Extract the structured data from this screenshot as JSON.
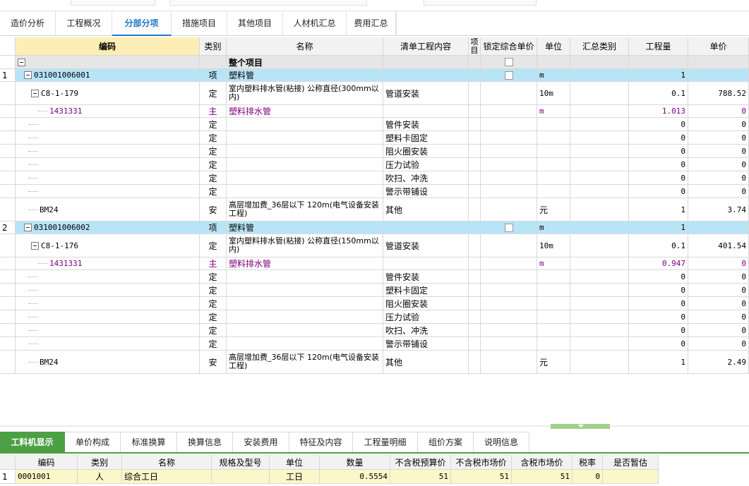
{
  "tabs": [
    "造价分析",
    "工程概况",
    "分部分项",
    "措施项目",
    "其他项目",
    "人材机汇总",
    "费用汇总"
  ],
  "active_tab": 2,
  "columns": {
    "code": "编码",
    "type": "类别",
    "name": "名称",
    "content": "清单工程内容",
    "item": "项目",
    "lock": "锁定综合单价",
    "unit": "单位",
    "sum_cat": "汇总类别",
    "qty": "工程量",
    "price": "单价"
  },
  "total_row": {
    "name": "整个项目"
  },
  "groups": [
    {
      "index": "1",
      "code": "031001006001",
      "type": "项",
      "name": "塑料管",
      "unit": "m",
      "qty": "1",
      "quota": {
        "code": "C8-1-179",
        "type": "定",
        "name": "室内塑料排水管(粘接) 公称直径(300mm以内)",
        "content": "管道安装",
        "unit": "10m",
        "qty": "0.1",
        "price": "788.52"
      },
      "material": {
        "code": "1431331",
        "type": "主",
        "name": "塑料排水管",
        "unit": "m",
        "qty": "1.013",
        "price": "0"
      },
      "subs": [
        {
          "type": "定",
          "content": "管件安装",
          "qty": "0",
          "price": "0"
        },
        {
          "type": "定",
          "content": "塑料卡固定",
          "qty": "0",
          "price": "0"
        },
        {
          "type": "定",
          "content": "阻火圈安装",
          "qty": "0",
          "price": "0"
        },
        {
          "type": "定",
          "content": "压力试验",
          "qty": "0",
          "price": "0"
        },
        {
          "type": "定",
          "content": "吹扫、冲洗",
          "qty": "0",
          "price": "0"
        },
        {
          "type": "定",
          "content": "警示带铺设",
          "qty": "0",
          "price": "0"
        }
      ],
      "extra": {
        "code": "BM24",
        "type": "安",
        "name": "高层增加费_36层以下 120m(电气设备安装工程)",
        "content": "其他",
        "unit": "元",
        "qty": "1",
        "price": "3.74"
      }
    },
    {
      "index": "2",
      "code": "031001006002",
      "type": "项",
      "name": "塑料管",
      "unit": "m",
      "qty": "1",
      "quota": {
        "code": "C8-1-176",
        "type": "定",
        "name": "室内塑料排水管(粘接) 公称直径(150mm以内)",
        "content": "管道安装",
        "unit": "10m",
        "qty": "0.1",
        "price": "401.54"
      },
      "material": {
        "code": "1431331",
        "type": "主",
        "name": "塑料排水管",
        "unit": "m",
        "qty": "0.947",
        "price": "0"
      },
      "subs": [
        {
          "type": "定",
          "content": "管件安装",
          "qty": "0",
          "price": "0"
        },
        {
          "type": "定",
          "content": "塑料卡固定",
          "qty": "0",
          "price": "0"
        },
        {
          "type": "定",
          "content": "阻火圈安装",
          "qty": "0",
          "price": "0"
        },
        {
          "type": "定",
          "content": "压力试验",
          "qty": "0",
          "price": "0"
        },
        {
          "type": "定",
          "content": "吹扫、冲洗",
          "qty": "0",
          "price": "0"
        },
        {
          "type": "定",
          "content": "警示带铺设",
          "qty": "0",
          "price": "0"
        }
      ],
      "extra": {
        "code": "BM24",
        "type": "安",
        "name": "高层增加费_36层以下 120m(电气设备安装工程)",
        "content": "其他",
        "unit": "元",
        "qty": "1",
        "price": "2.49"
      }
    }
  ],
  "bottom_tabs": [
    "工料机显示",
    "单价构成",
    "标准换算",
    "换算信息",
    "安装费用",
    "特征及内容",
    "工程量明细",
    "组价方案",
    "说明信息"
  ],
  "bottom_active": 0,
  "bottom_columns": [
    "编码",
    "类别",
    "名称",
    "规格及型号",
    "单位",
    "数量",
    "不含税预算价",
    "不含税市场价",
    "含税市场价",
    "税率",
    "是否暂估"
  ],
  "bottom_rows": [
    {
      "index": "1",
      "cells": [
        "0001001",
        "人",
        "综合工日",
        "",
        "工日",
        "0.5554",
        "51",
        "51",
        "51",
        "0",
        ""
      ]
    }
  ],
  "colors": {
    "accent_blue": "#1e76c8",
    "item_row": "#b8e4f8",
    "code_header": "#fdeeb5",
    "material_text": "#800080",
    "green": "#4ba043",
    "bottom_row": "#fbf7c8"
  }
}
